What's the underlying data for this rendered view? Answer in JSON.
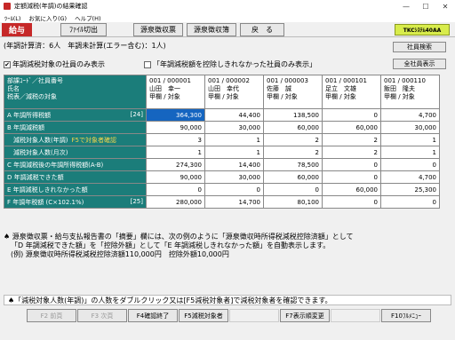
{
  "window": {
    "title": "定額減税(年調)の結果確認",
    "minimize_glyph": "—",
    "maximize_glyph": "☐",
    "close_glyph": "✕"
  },
  "menu": {
    "items": [
      "ﾂｰﾙ(L)",
      "お気に入り(G)",
      "ヘルプ(H)"
    ]
  },
  "toolbar": {
    "label": "給与",
    "buttons": [
      "ﾌｧｲﾙ切出",
      "源泉徴収票",
      "源泉徴収簿",
      "戻　る"
    ],
    "logo": "TKCｼｽﾃﾑ40AA"
  },
  "status": "(年調計算済：6人　年調未計算(エラー含む)：1人)",
  "buttons": {
    "employee_search": "社員検索",
    "all_employees": "全社員表示"
  },
  "filters": {
    "only_targets": {
      "checked": true,
      "label": "年調減税対象の社員のみ表示"
    },
    "not_deducted": {
      "checked": false,
      "label": "「年調減税額を控除しきれなかった社員のみ表示」"
    }
  },
  "grid": {
    "header": [
      "部課ｺｰﾄﾞ／社員番号",
      "氏名",
      "税表／減税の対象"
    ],
    "employees": [
      {
        "code": "001 / 000001",
        "name": "山田　幸一",
        "type": "甲欄 / 対象"
      },
      {
        "code": "001 / 000002",
        "name": "山田　幸代",
        "type": "甲欄 / 対象"
      },
      {
        "code": "001 / 000003",
        "name": "佐藤　誠",
        "type": "甲欄 / 対象"
      },
      {
        "code": "001 / 000101",
        "name": "足立　文雄",
        "type": "甲欄 / 対象"
      },
      {
        "code": "001 / 000110",
        "name": "飯田　隆夫",
        "type": "甲欄 / 対象"
      }
    ],
    "rows": [
      {
        "label": "A 年調所得税額",
        "tag": "[24]",
        "hint": "",
        "values": [
          "364,300",
          "44,400",
          "138,500",
          "0",
          "4,700"
        ]
      },
      {
        "label": "B 年調減税額",
        "tag": "",
        "hint": "",
        "values": [
          "90,000",
          "30,000",
          "60,000",
          "60,000",
          "30,000"
        ]
      },
      {
        "label": "減税対象人数(年調)",
        "tag": "",
        "hint": "F5で対象者確認",
        "values": [
          "3",
          "1",
          "2",
          "2",
          "1"
        ]
      },
      {
        "label": "減税対象人数(月次)",
        "tag": "",
        "hint": "",
        "values": [
          "1",
          "1",
          "2",
          "2",
          "1"
        ]
      },
      {
        "label": "C 年調減税後の年調所得税額(A-B)",
        "tag": "",
        "hint": "",
        "values": [
          "274,300",
          "14,400",
          "78,500",
          "0",
          "0"
        ]
      },
      {
        "label": "D 年調減税できた額",
        "tag": "",
        "hint": "",
        "values": [
          "90,000",
          "30,000",
          "60,000",
          "0",
          "4,700"
        ]
      },
      {
        "label": "E 年調減税しきれなかった額",
        "tag": "",
        "hint": "",
        "values": [
          "0",
          "0",
          "0",
          "60,000",
          "25,300"
        ]
      },
      {
        "label": "F 年調年税額 (C×102.1%)",
        "tag": "[25]",
        "hint": "",
        "values": [
          "280,000",
          "14,700",
          "80,100",
          "0",
          "0"
        ]
      }
    ]
  },
  "notes": [
    "♠ 源泉徴収票・給与支払報告書の「摘要」欄には、次の例のように「源泉徴収時所得税減税控除済額」として",
    "「D 年調減税できた額」を「控除外額」として「E 年調減税しきれなかった額」を自動表示します。",
    "(例) 源泉徴収時所得税減税控除済額110,000円　控除外額10,000円"
  ],
  "footer_message": "♠「減税対象人数(年調)」の人数をダブルクリック又は[F5減税対象者]で減税対象者を確認できます。",
  "fkeys": [
    "F2 前頁",
    "F3 次頁",
    "F4確認終了",
    "F5減税対象者",
    "",
    "F7表示順変更",
    "",
    "F10ﾌﾙﾒﾆｭｰ"
  ]
}
